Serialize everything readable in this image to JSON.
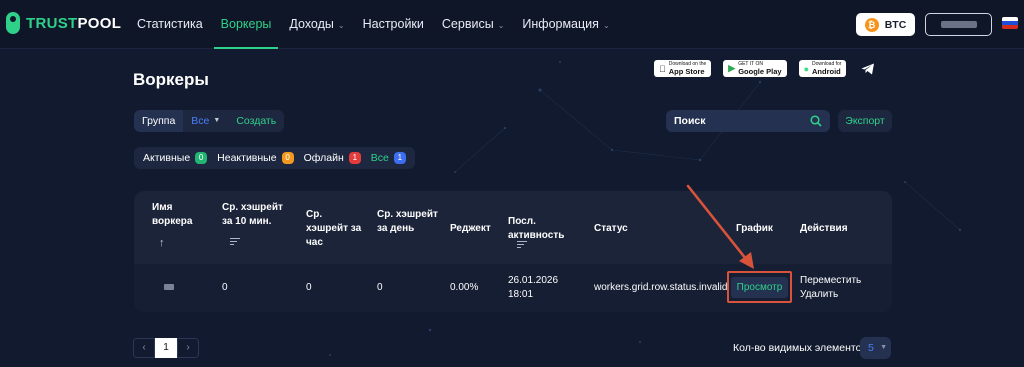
{
  "logo": {
    "brand_prefix": "TRUST",
    "brand_suffix": "POOL"
  },
  "nav": {
    "items": [
      {
        "label": "Статистика",
        "dropdown": false,
        "active": false
      },
      {
        "label": "Воркеры",
        "dropdown": false,
        "active": true
      },
      {
        "label": "Доходы",
        "dropdown": true,
        "active": false
      },
      {
        "label": "Настройки",
        "dropdown": false,
        "active": false
      },
      {
        "label": "Сервисы",
        "dropdown": true,
        "active": false
      },
      {
        "label": "Информация",
        "dropdown": true,
        "active": false
      }
    ],
    "coin": {
      "label": "BTC",
      "icon": "bitcoin-icon"
    },
    "language_flag": "russia-flag-icon"
  },
  "page": {
    "title": "Воркеры"
  },
  "apps": {
    "app_store": {
      "small": "Download on the",
      "big": "App Store"
    },
    "google_play": {
      "small": "GET IT ON",
      "big": "Google Play"
    },
    "android": {
      "small": "Download for",
      "big": "Android"
    },
    "telegram_icon": "telegram-icon"
  },
  "toolbar": {
    "group_label": "Группа",
    "group_value": "Все",
    "create_label": "Создать",
    "search_placeholder": "Поиск",
    "export_label": "Экспорт"
  },
  "filters": [
    {
      "label": "Активные",
      "count": "0",
      "color": "#22b573"
    },
    {
      "label": "Неактивные",
      "count": "0",
      "color": "#f29a1f"
    },
    {
      "label": "Офлайн",
      "count": "1",
      "color": "#e23b3b"
    },
    {
      "label": "Все",
      "count": "1",
      "color": "#3d6ef0"
    }
  ],
  "table": {
    "headers": {
      "name": "Имя воркера",
      "hashrate_10m": "Ср. хэшрейт за 10 мин.",
      "hashrate_hour": "Ср. хэшрейт за час",
      "hashrate_day": "Ср. хэшрейт за день",
      "reject": "Реджект",
      "last_activity": "Посл. активность",
      "status": "Статус",
      "chart": "График",
      "actions": "Действия"
    },
    "rows": [
      {
        "hashrate_10m": "0",
        "hashrate_hour": "0",
        "hashrate_day": "0",
        "reject": "0.00%",
        "last_activity_date": "26.01.2026",
        "last_activity_time": "18:01",
        "status": "workers.grid.row.status.invalid",
        "chart_label": "Просмотр",
        "move_label": "Переместить",
        "delete_label": "Удалить"
      }
    ]
  },
  "pagination": {
    "prev": "‹",
    "current": "1",
    "next": "›"
  },
  "page_size": {
    "label": "Кол-во видимых элементов",
    "value": "5"
  },
  "colors": {
    "accent_green": "#2fd18a",
    "accent_blue": "#4a7cf6",
    "danger_red": "#e23b3b",
    "annotation": "#d9533b",
    "background": "#111a2e"
  }
}
